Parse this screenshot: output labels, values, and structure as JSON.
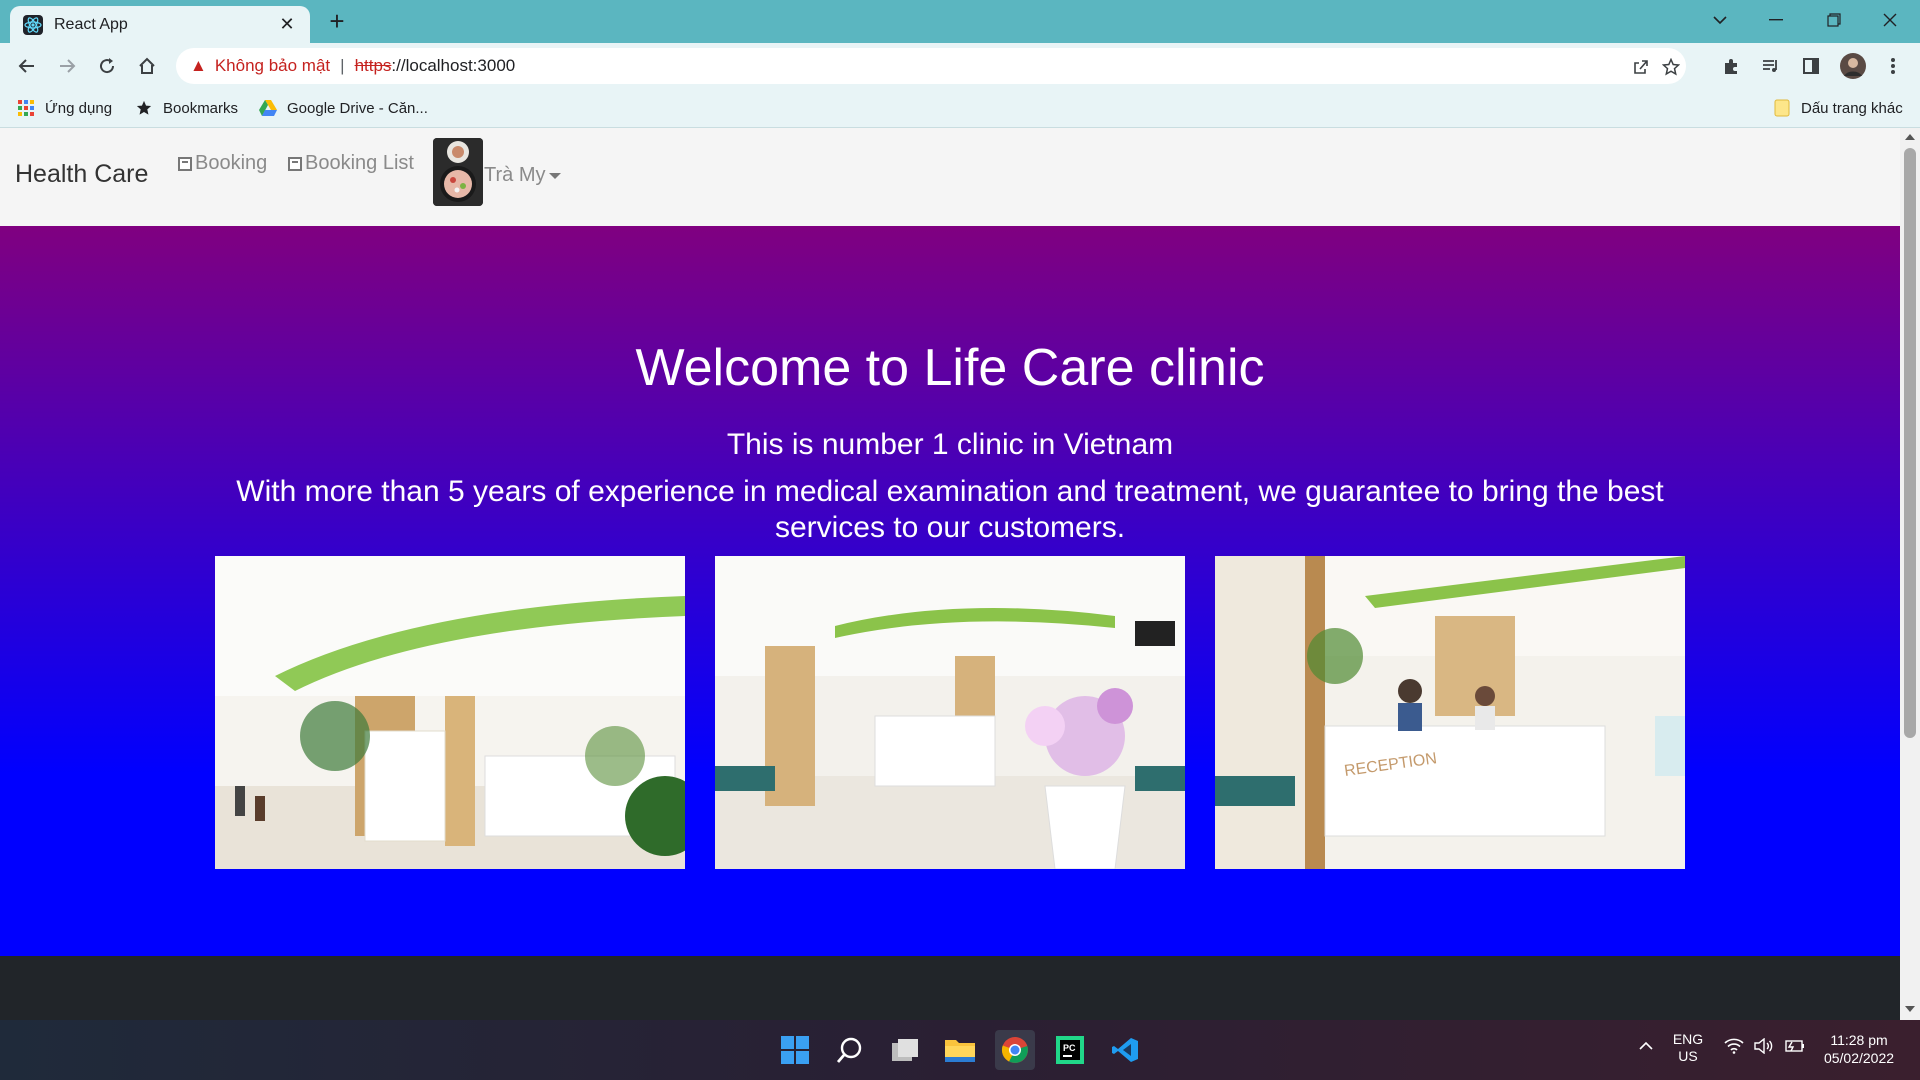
{
  "browser": {
    "tab_title": "React App",
    "url_security": "Không bảo mật",
    "url_scheme": "https",
    "url_host": "://localhost:3000",
    "bookmarks": {
      "apps": "Ứng dụng",
      "bookmarks": "Bookmarks",
      "drive": "Google Drive - Căn...",
      "other": "Dấu trang khác"
    }
  },
  "navbar": {
    "brand": "Health Care",
    "links": [
      "Booking",
      "Booking List"
    ],
    "user_name": "Trà My"
  },
  "hero": {
    "title": "Welcome to Life Care clinic",
    "subtitle": "This is number 1 clinic in Vietnam",
    "description": "With more than 5 years of experience in medical examination and treatment, we guarantee to bring the best services to our customers.",
    "photos": [
      "clinic-lobby-photo",
      "clinic-hallway-photo",
      "clinic-reception-photo"
    ],
    "reception_sign": "RECEPTION"
  },
  "taskbar": {
    "lang_top": "ENG",
    "lang_bottom": "US",
    "time": "11:28 pm",
    "date": "05/02/2022"
  },
  "colors": {
    "tab_strip": "#5bb6c0",
    "hero_top": "#800080",
    "hero_bottom": "#0000ff",
    "footer": "#212529"
  }
}
